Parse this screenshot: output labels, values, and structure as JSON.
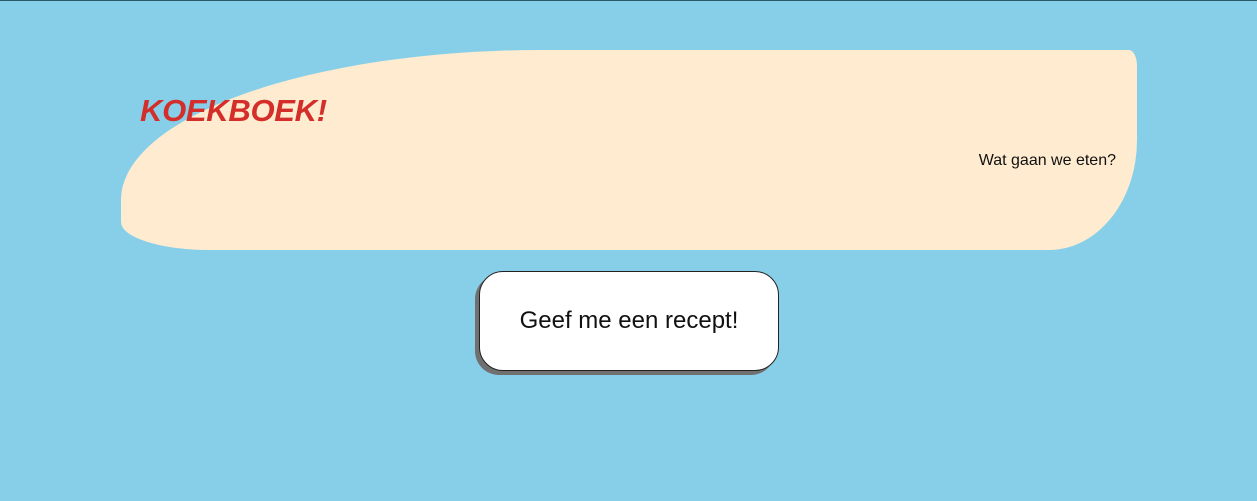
{
  "header": {
    "title": "KOEKBOEK!",
    "tagline": "Wat gaan we eten?"
  },
  "main": {
    "recipe_button_label": "Geef me een recept!"
  },
  "colors": {
    "background": "#87cfe9",
    "header_bg": "#ffebcf",
    "title": "#d32e2a",
    "button_bg": "#ffffff"
  }
}
